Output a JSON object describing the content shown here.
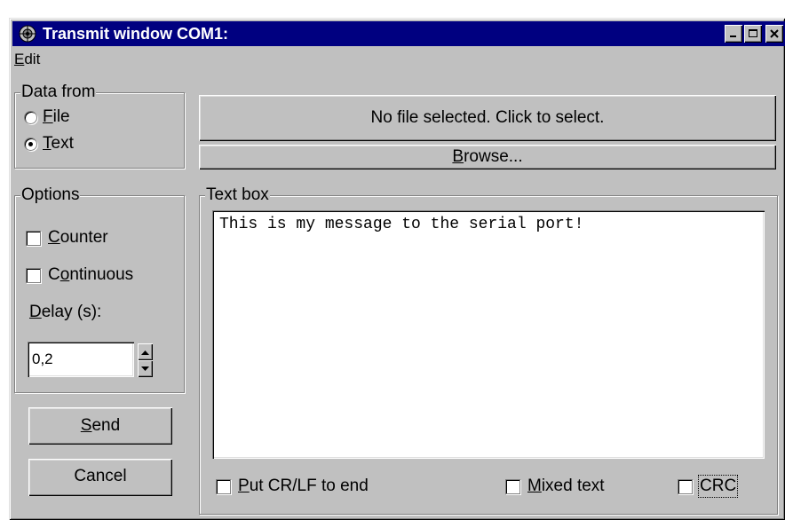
{
  "window": {
    "title": "Transmit window COM1:",
    "title_bar_color": "#000080",
    "controls": [
      "minimize-icon",
      "maximize-icon",
      "close-icon"
    ]
  },
  "menu": {
    "items": [
      {
        "label": "Edit",
        "mnemonic": "E"
      }
    ]
  },
  "data_from": {
    "legend": "Data from",
    "options": [
      {
        "label": "File",
        "mnemonic": "F",
        "selected": false
      },
      {
        "label": "Text",
        "mnemonic": "T",
        "selected": true
      }
    ]
  },
  "file": {
    "status": "No file selected. Click to select.",
    "browse_label": "Browse..."
  },
  "options": {
    "legend": "Options",
    "counter_label": "Counter",
    "counter_checked": false,
    "continuous_label": "Continuous",
    "continuous_checked": false,
    "delay_label": "Delay (s):",
    "delay_value": "0,2"
  },
  "actions": {
    "send_label": "Send",
    "cancel_label": "Cancel"
  },
  "textbox": {
    "legend": "Text box",
    "value": "This is my message to the serial port!"
  },
  "bottom_options": {
    "crlf_label": "Put CR/LF to end",
    "crlf_checked": false,
    "mixed_label": "Mixed text",
    "mixed_checked": false,
    "crc_label": "CRC",
    "crc_checked": false
  }
}
